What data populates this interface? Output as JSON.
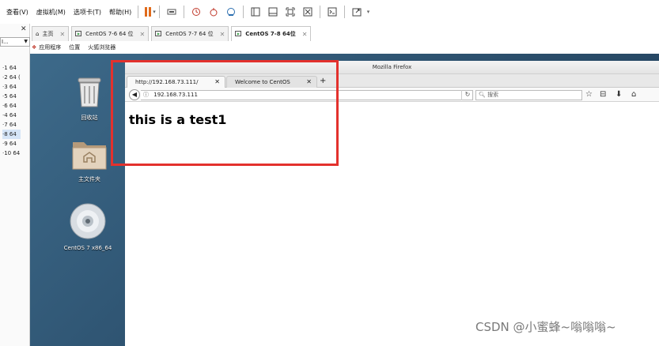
{
  "menubar": {
    "items": [
      "查看(V)",
      "虚拟机(M)",
      "选项卡(T)",
      "帮助(H)"
    ]
  },
  "library": {
    "search_value": "I...",
    "rows": [
      "·1 64",
      "·2 64 (",
      "·3 64",
      "·5 64",
      "·6 64",
      "·4 64",
      "·7 64",
      "·8 64",
      "·9 64",
      "·10 64"
    ]
  },
  "vm_tabs": [
    {
      "label": "主页",
      "active": false
    },
    {
      "label": "CentOS 7-6  64 位",
      "active": false
    },
    {
      "label": "CentOS 7-7  64 位",
      "active": false
    },
    {
      "label": "CentOS 7-8  64位",
      "active": true
    }
  ],
  "gnome_menu": {
    "apps": "应用程序",
    "places": "位置",
    "firefox": "火狐浏览器"
  },
  "desktop": {
    "trash_label": "回收站",
    "home_label": "主文件夹",
    "disc_label": "CentOS 7 x86_64"
  },
  "firefox": {
    "window_title": "Mozilla Firefox",
    "tabs": [
      {
        "title": "http://192.168.73.111/"
      },
      {
        "title": "Welcome to CentOS"
      }
    ],
    "url": "192.168.73.111",
    "search_placeholder": "搜索",
    "page_text": "this is a test1"
  },
  "watermark": "CSDN @小蜜蜂~嗡嗡嗡~",
  "colors": {
    "highlight": "#e3312d",
    "pause": "#e06a1a",
    "desktop": "#2f5575"
  }
}
